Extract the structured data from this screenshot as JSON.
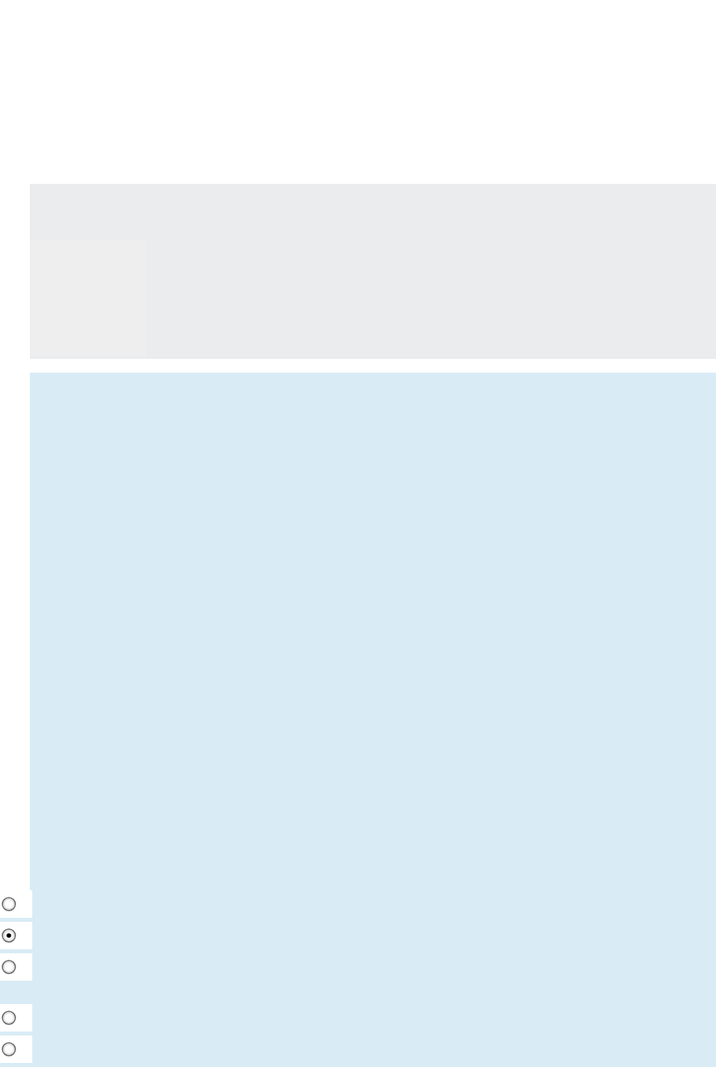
{
  "radio_groups": [
    {
      "options": [
        {
          "selected": false
        },
        {
          "selected": true
        },
        {
          "selected": false
        }
      ]
    },
    {
      "options": [
        {
          "selected": false
        },
        {
          "selected": false
        }
      ]
    }
  ]
}
